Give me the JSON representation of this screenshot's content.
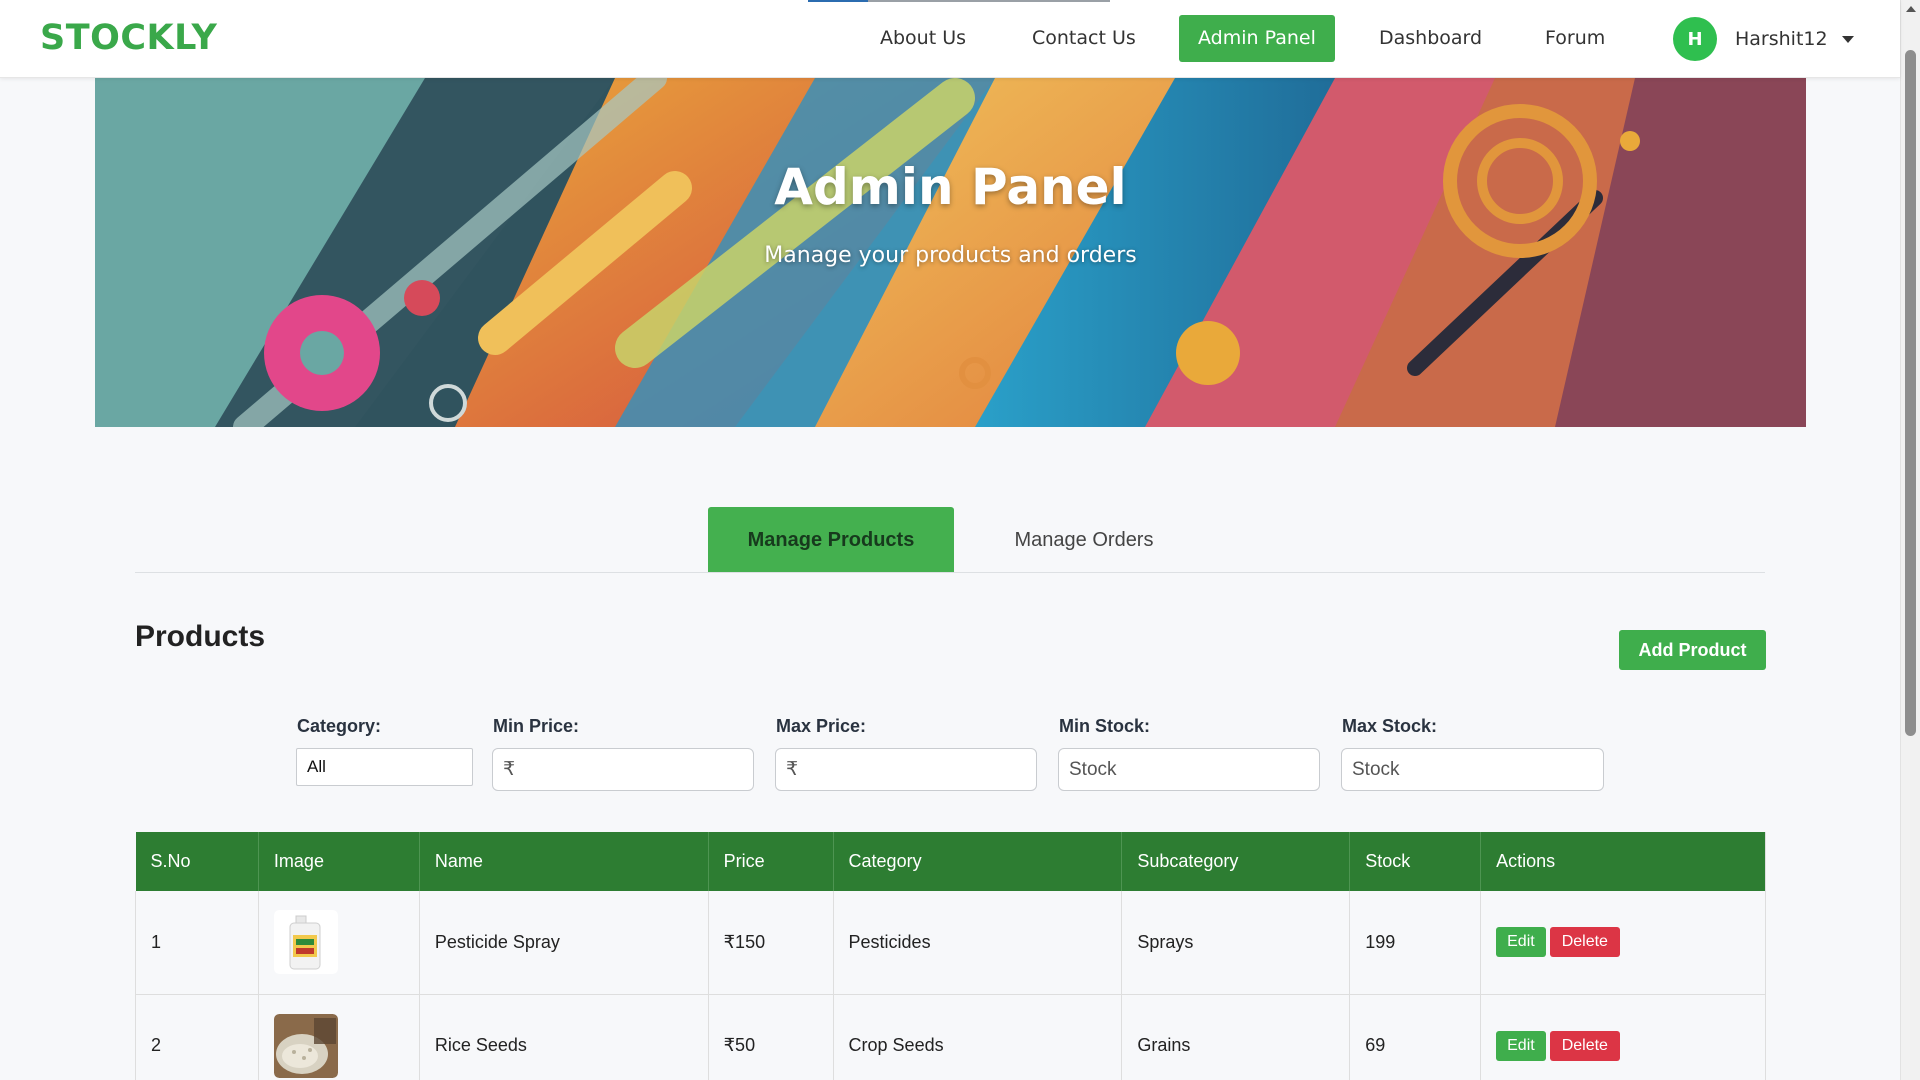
{
  "brand": "STOCKLY",
  "nav": {
    "about": "About Us",
    "contact": "Contact Us",
    "admin": "Admin Panel",
    "dashboard": "Dashboard",
    "forum": "Forum"
  },
  "user": {
    "initial": "H",
    "name": "Harshit12"
  },
  "hero": {
    "title": "Admin Panel",
    "subtitle": "Manage your products and orders"
  },
  "tabs": {
    "products": "Manage Products",
    "orders": "Manage Orders"
  },
  "products": {
    "title": "Products",
    "add_button": "Add Product"
  },
  "filters": {
    "category_label": "Category:",
    "category_value": "All",
    "min_price_label": "Min Price:",
    "min_price_placeholder": "₹",
    "max_price_label": "Max Price:",
    "max_price_placeholder": "₹",
    "min_stock_label": "Min Stock:",
    "min_stock_placeholder": "Stock",
    "max_stock_label": "Max Stock:",
    "max_stock_placeholder": "Stock"
  },
  "table": {
    "columns": [
      "S.No",
      "Image",
      "Name",
      "Price",
      "Category",
      "Subcategory",
      "Stock",
      "Actions"
    ],
    "rows": [
      {
        "sno": "1",
        "name": "Pesticide Spray",
        "price": "₹150",
        "category": "Pesticides",
        "subcategory": "Sprays",
        "stock": "199",
        "edit": "Edit",
        "delete": "Delete"
      },
      {
        "sno": "2",
        "name": "Rice Seeds",
        "price": "₹50",
        "category": "Crop Seeds",
        "subcategory": "Grains",
        "stock": "69",
        "edit": "Edit",
        "delete": "Delete"
      }
    ]
  },
  "colors": {
    "brand": "#3aa84a",
    "primary": "#3fae4c",
    "table_header": "#2d7d32",
    "danger": "#dc3545"
  },
  "icons": {
    "user_menu": "caret-down-icon",
    "scroll": "scroll-up-arrow-icon"
  }
}
